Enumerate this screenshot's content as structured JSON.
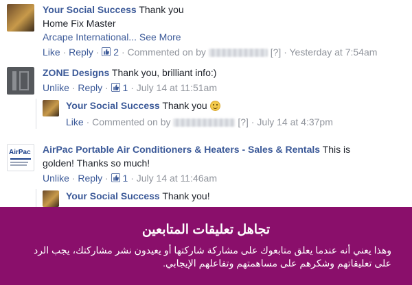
{
  "comments": [
    {
      "author": "Your Social Success",
      "text": " Thank you",
      "line2": "Home Fix Master",
      "line3_link": "Arcape International...",
      "see_more": " See More",
      "action1": "Like",
      "action2": "Reply",
      "likes": "2",
      "commented_on_by": "Commented on by",
      "flag": "[?]",
      "time": "Yesterday at 7:54am"
    },
    {
      "author": "ZONE Designs",
      "text": " Thank you, brilliant info:)",
      "action1": "Unlike",
      "action2": "Reply",
      "likes": "1",
      "time": "July 14 at 11:51am",
      "reply": {
        "author": "Your Social Success",
        "text": " Thank you ",
        "action1": "Like",
        "commented_on_by": "Commented on by",
        "flag": "[?]",
        "time": "July 14 at 4:37pm"
      }
    },
    {
      "author": "AirPac Portable Air Conditioners & Heaters - Sales & Rentals",
      "text": " This is",
      "line2": "golden! Thanks so much!",
      "action1": "Unlike",
      "action2": "Reply",
      "likes": "1",
      "time": "July 14 at 11:46am",
      "avatar_text": "AirPac",
      "reply": {
        "author": "Your Social Success",
        "text": " Thank you!"
      }
    }
  ],
  "separator": "·",
  "banner": {
    "title": "تجاهل تعليقات المتابعين",
    "body": "وهذا يعني أنه عندما يعلق متابعوك على مشاركة شاركتها أو يعيدون نشر مشاركتك، يجب الرد على تعليقاتهم وشكرهم على مساهمتهم وتفاعلهم الإيجابي."
  },
  "colors": {
    "link": "#3b5998",
    "meta": "#90949c",
    "banner": "#8a0f6b"
  }
}
